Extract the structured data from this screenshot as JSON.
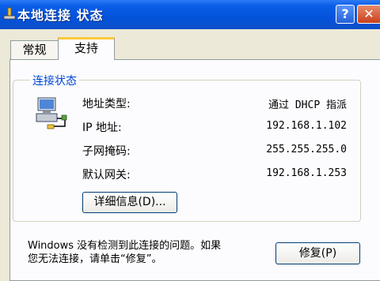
{
  "window": {
    "title": "本地连接 状态",
    "help_label": "?",
    "close_label": "✕"
  },
  "tabs": [
    {
      "label": "常规"
    },
    {
      "label": "支持"
    }
  ],
  "status_group": {
    "label": "连接状态",
    "rows": [
      {
        "label": "地址类型:",
        "value": "通过 DHCP 指派"
      },
      {
        "label": "IP 地址:",
        "value": "192.168.1.102"
      },
      {
        "label": "子网掩码:",
        "value": "255.255.255.0"
      },
      {
        "label": "默认网关:",
        "value": "192.168.1.253"
      }
    ],
    "details_button": "详细信息(D)..."
  },
  "footer": {
    "message_line1": "Windows 没有检测到此连接的问题。如果",
    "message_line2": "您无法连接，请单击“修复”。",
    "repair_button": "修复(P)"
  },
  "colors": {
    "titlebar": "#0453db",
    "group_label": "#0046d5",
    "tab_highlight": "#ffc83c"
  }
}
